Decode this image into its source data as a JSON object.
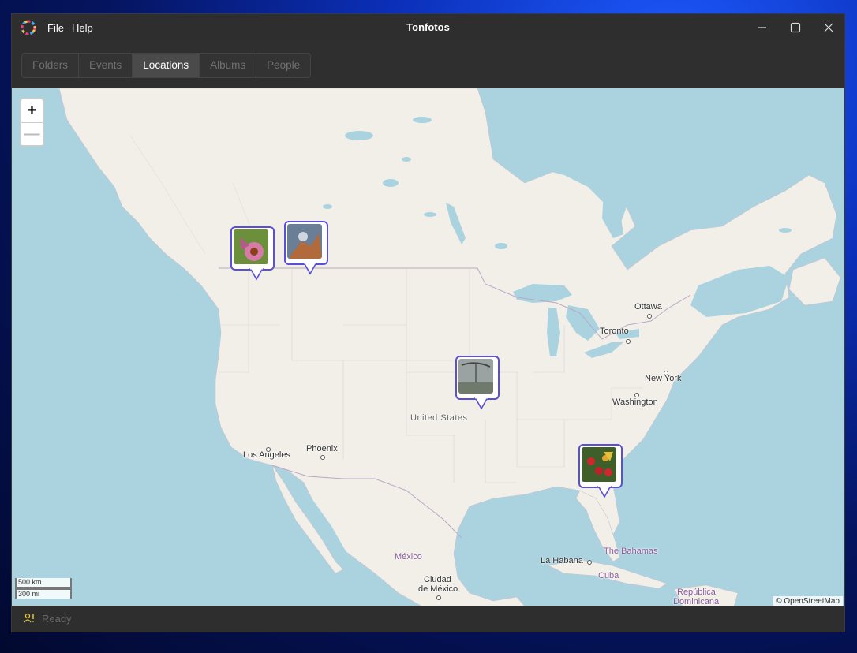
{
  "app": {
    "title": "Tonfotos",
    "icon": "app-logo-icon"
  },
  "menu": {
    "file": "File",
    "help": "Help"
  },
  "window_controls": {
    "minimize": "minimize-icon",
    "maximize": "maximize-icon",
    "close": "close-icon"
  },
  "tabs": [
    {
      "label": "Folders",
      "active": false
    },
    {
      "label": "Events",
      "active": false
    },
    {
      "label": "Locations",
      "active": true
    },
    {
      "label": "Albums",
      "active": false
    },
    {
      "label": "People",
      "active": false
    }
  ],
  "map": {
    "zoom_in": "+",
    "zoom_out": "—",
    "scale_km": "500 km",
    "scale_mi": "300 mi",
    "attribution": "© OpenStreetMap",
    "places": {
      "ottawa": "Ottawa",
      "toronto": "Toronto",
      "new_york": "New York",
      "washington": "Washington",
      "united_states": "United States",
      "phoenix": "Phoenix",
      "los_angeles": "Los Angeles",
      "mexico": "México",
      "ciudad_1": "Ciudad",
      "ciudad_2": "de México",
      "la_habana": "La Habana",
      "bahamas": "The Bahamas",
      "cuba": "Cuba",
      "republica_1": "República",
      "republica_2": "Dominicana"
    },
    "markers": [
      {
        "name": "flower-photo"
      },
      {
        "name": "bird-photo"
      },
      {
        "name": "foggy-tree-photo"
      },
      {
        "name": "red-berries-photo"
      }
    ]
  },
  "status": {
    "text": "Ready",
    "icon": "person-alert-icon"
  },
  "colors": {
    "accent": "#5a4fd9",
    "water": "#aad3df",
    "land": "#f2efe9"
  }
}
